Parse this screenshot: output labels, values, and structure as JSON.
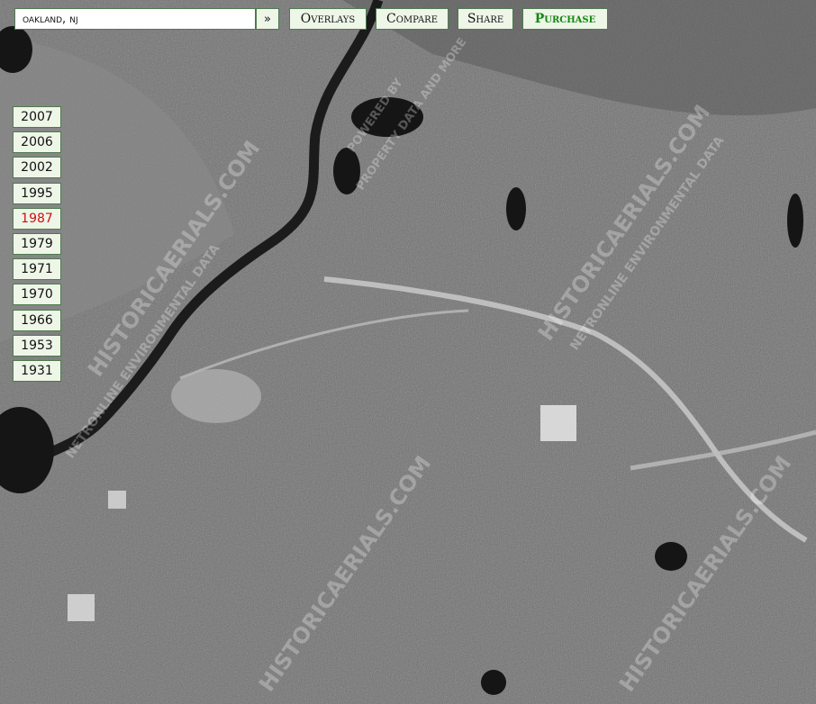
{
  "search": {
    "value": "oakland, nj",
    "go_label": "»"
  },
  "toolbar": {
    "overlays": "Overlays",
    "compare": "Compare",
    "share": "Share",
    "purchase": "Purchase"
  },
  "years": [
    "2007",
    "2006",
    "2002",
    "1995",
    "1987",
    "1979",
    "1971",
    "1970",
    "1966",
    "1953",
    "1931"
  ],
  "selected_year": "1987",
  "watermarks": [
    "HISTORICAERIALS.COM",
    "NETRONLINE ENVIRONMENTAL DATA",
    "POWERED BY",
    "PROPERTY DATA AND MORE"
  ],
  "colors": {
    "button_bg": "#eef6e8",
    "button_border": "#4f7a4f",
    "purchase": "#118811",
    "active_year": "#cc1111"
  }
}
